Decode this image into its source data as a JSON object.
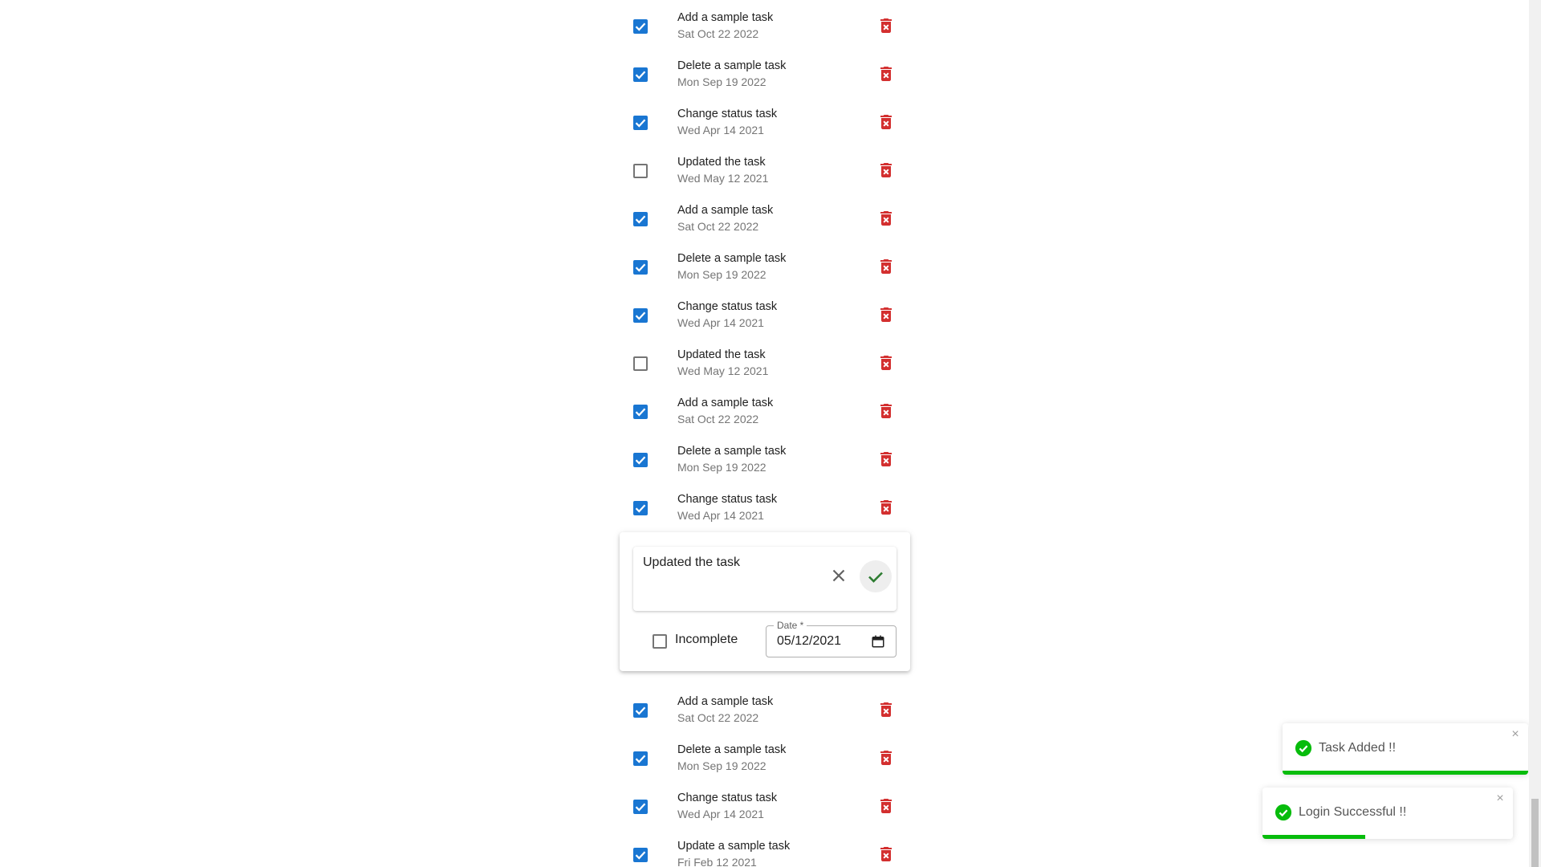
{
  "tasks_top": [
    {
      "title": "Add a sample task",
      "date": "Sat Oct 22 2022",
      "checked": true
    },
    {
      "title": "Delete a sample task",
      "date": "Mon Sep 19 2022",
      "checked": true
    },
    {
      "title": "Change status task",
      "date": "Wed Apr 14 2021",
      "checked": true
    },
    {
      "title": "Updated the task",
      "date": "Wed May 12 2021",
      "checked": false
    },
    {
      "title": "Add a sample task",
      "date": "Sat Oct 22 2022",
      "checked": true
    },
    {
      "title": "Delete a sample task",
      "date": "Mon Sep 19 2022",
      "checked": true
    },
    {
      "title": "Change status task",
      "date": "Wed Apr 14 2021",
      "checked": true
    },
    {
      "title": "Updated the task",
      "date": "Wed May 12 2021",
      "checked": false
    },
    {
      "title": "Add a sample task",
      "date": "Sat Oct 22 2022",
      "checked": true
    },
    {
      "title": "Delete a sample task",
      "date": "Mon Sep 19 2022",
      "checked": true
    },
    {
      "title": "Change status task",
      "date": "Wed Apr 14 2021",
      "checked": true
    }
  ],
  "edit_panel": {
    "text": "Updated the task",
    "status_label": "Incomplete",
    "status_checked": false,
    "date_label": "Date *",
    "date_value": "05/12/2021"
  },
  "tasks_bottom": [
    {
      "title": "Add a sample task",
      "date": "Sat Oct 22 2022",
      "checked": true
    },
    {
      "title": "Delete a sample task",
      "date": "Mon Sep 19 2022",
      "checked": true
    },
    {
      "title": "Change status task",
      "date": "Wed Apr 14 2021",
      "checked": true
    },
    {
      "title": "Update a sample task",
      "date": "Fri Feb 12 2021",
      "checked": true
    }
  ],
  "toasts": [
    {
      "text": "Task Added !!",
      "close": "×",
      "progress": 1.0
    },
    {
      "text": "Login Successful !!",
      "close": "×",
      "progress": 0.41
    }
  ],
  "colors": {
    "accent": "#1976d2",
    "delete": "#d32f2f",
    "success": "#07bc0c",
    "confirm": "#2e7d32"
  },
  "icons": {
    "checkbox": "check-box-icon",
    "delete": "delete-forever-icon",
    "cancel": "close-icon",
    "confirm": "check-icon",
    "calendar": "calendar-icon",
    "toast": "check-circle-icon"
  }
}
